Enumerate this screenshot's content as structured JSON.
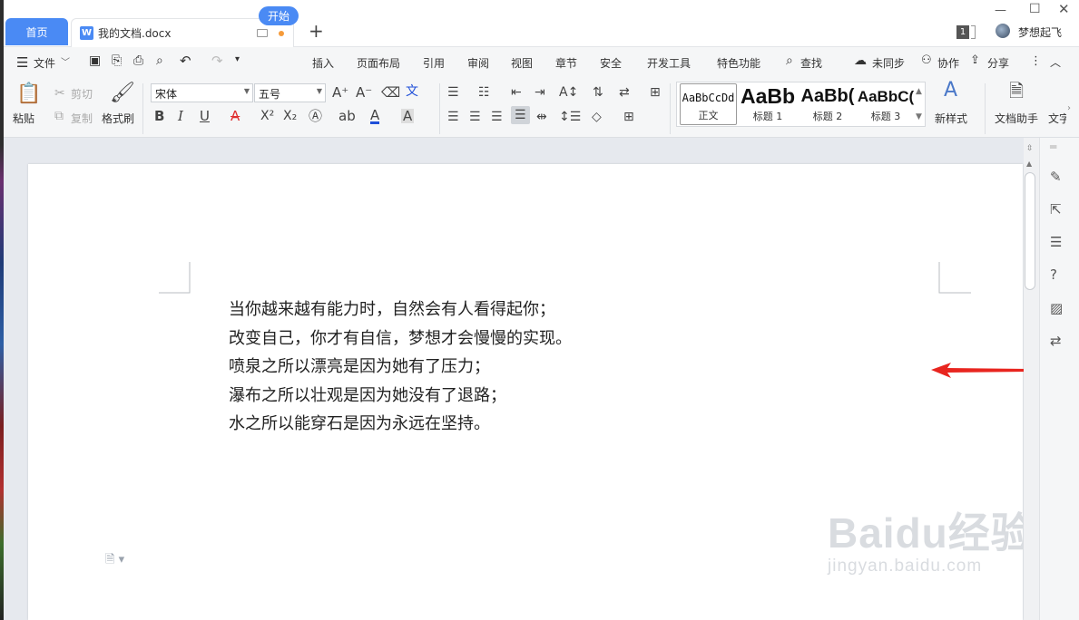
{
  "tabs": {
    "home": "首页",
    "doc": "我的文档.docx",
    "new": "+"
  },
  "account": {
    "badge": "1",
    "name": "梦想起飞"
  },
  "menu": {
    "items": [
      "文件",
      "开始",
      "插入",
      "页面布局",
      "引用",
      "审阅",
      "视图",
      "章节",
      "安全",
      "开发工具",
      "特色功能",
      "查找"
    ],
    "right": [
      "未同步",
      "协作",
      "分享"
    ]
  },
  "ribbon": {
    "paste": "粘贴",
    "cut": "剪切",
    "copy": "复制",
    "format_painter": "格式刷",
    "font": "宋体",
    "size": "五号",
    "styles": [
      {
        "preview": "AaBbCcDd",
        "label": "正文"
      },
      {
        "preview": "AaBb",
        "label": "标题 1"
      },
      {
        "preview": "AaBb(",
        "label": "标题 2"
      },
      {
        "preview": "AaBbC(",
        "label": "标题 3"
      }
    ],
    "new_style": "新样式",
    "doc_helper": "文档助手",
    "text_tool": "文字"
  },
  "document": {
    "lines": [
      "当你越来越有能力时，自然会有人看得起你；",
      "改变自己，你才有自信，梦想才会慢慢的实现。",
      "喷泉之所以漂亮是因为她有了压力；",
      "瀑布之所以壮观是因为她没有了退路；",
      "水之所以能穿石是因为永远在坚持。"
    ]
  },
  "watermark": {
    "brand": "Baidu经验",
    "url": "jingyan.baidu.com"
  },
  "colors": {
    "accent": "#4a8af4",
    "arrow": "#e8251f",
    "underline_red": "#e03030",
    "font_blue": "#1f4fd8"
  }
}
